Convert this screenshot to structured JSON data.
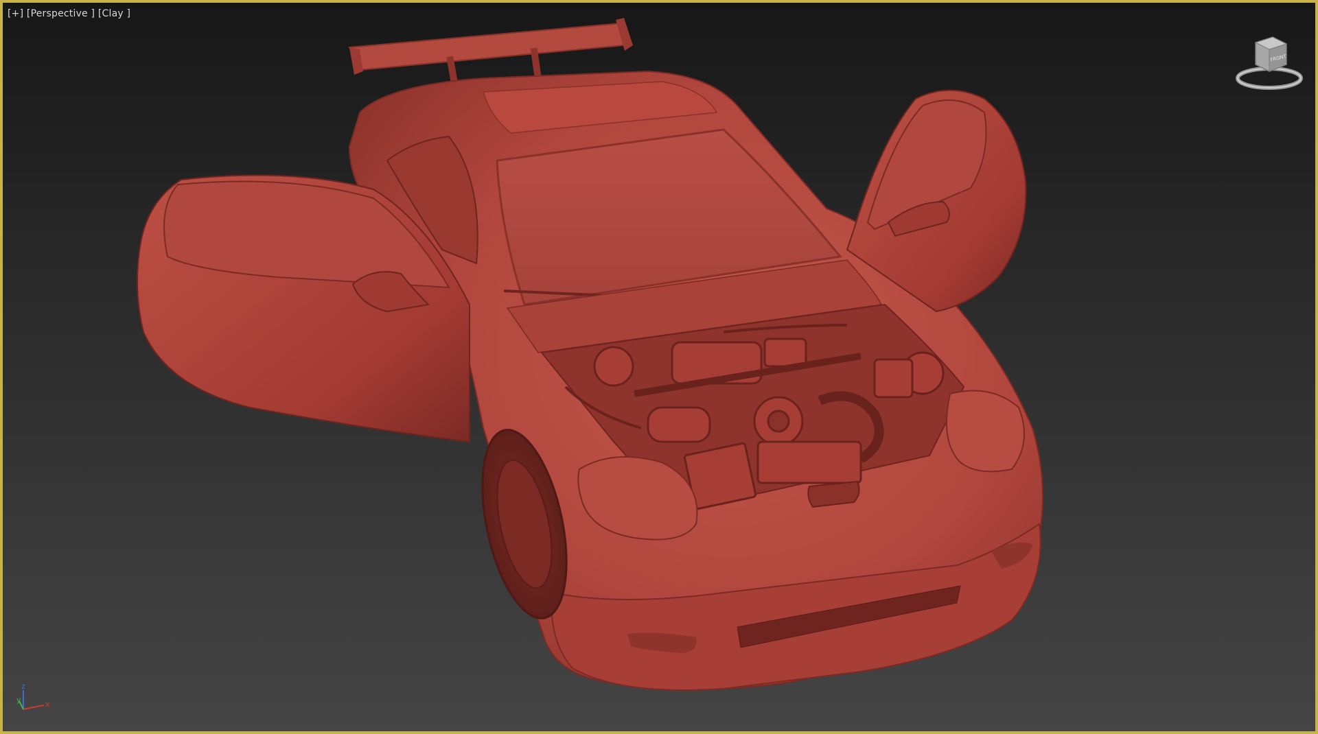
{
  "viewport": {
    "label_plus": "[+]",
    "label_view": "[Perspective ]",
    "label_shading": "[Clay ]",
    "border_color": "#c8b34a"
  },
  "viewcube": {
    "face_label": "FRONT",
    "icon": "viewcube-icon"
  },
  "axis_tripod": {
    "x": "x",
    "y": "y",
    "z": "z",
    "x_color": "#d13b2f",
    "y_color": "#3fb34f",
    "z_color": "#3f6ad8"
  },
  "model": {
    "clay_color": "#b4473e",
    "icon": "sports-car-model"
  }
}
